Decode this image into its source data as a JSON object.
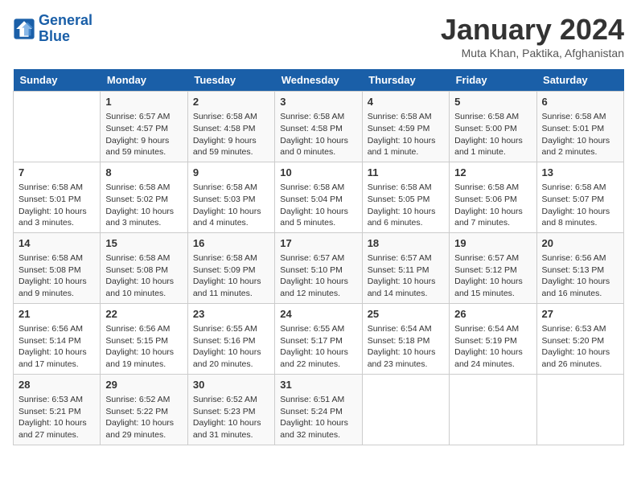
{
  "header": {
    "logo_line1": "General",
    "logo_line2": "Blue",
    "month": "January 2024",
    "location": "Muta Khan, Paktika, Afghanistan"
  },
  "days_of_week": [
    "Sunday",
    "Monday",
    "Tuesday",
    "Wednesday",
    "Thursday",
    "Friday",
    "Saturday"
  ],
  "weeks": [
    [
      {
        "num": "",
        "info": ""
      },
      {
        "num": "1",
        "info": "Sunrise: 6:57 AM\nSunset: 4:57 PM\nDaylight: 9 hours\nand 59 minutes."
      },
      {
        "num": "2",
        "info": "Sunrise: 6:58 AM\nSunset: 4:58 PM\nDaylight: 9 hours\nand 59 minutes."
      },
      {
        "num": "3",
        "info": "Sunrise: 6:58 AM\nSunset: 4:58 PM\nDaylight: 10 hours\nand 0 minutes."
      },
      {
        "num": "4",
        "info": "Sunrise: 6:58 AM\nSunset: 4:59 PM\nDaylight: 10 hours\nand 1 minute."
      },
      {
        "num": "5",
        "info": "Sunrise: 6:58 AM\nSunset: 5:00 PM\nDaylight: 10 hours\nand 1 minute."
      },
      {
        "num": "6",
        "info": "Sunrise: 6:58 AM\nSunset: 5:01 PM\nDaylight: 10 hours\nand 2 minutes."
      }
    ],
    [
      {
        "num": "7",
        "info": "Sunrise: 6:58 AM\nSunset: 5:01 PM\nDaylight: 10 hours\nand 3 minutes."
      },
      {
        "num": "8",
        "info": "Sunrise: 6:58 AM\nSunset: 5:02 PM\nDaylight: 10 hours\nand 3 minutes."
      },
      {
        "num": "9",
        "info": "Sunrise: 6:58 AM\nSunset: 5:03 PM\nDaylight: 10 hours\nand 4 minutes."
      },
      {
        "num": "10",
        "info": "Sunrise: 6:58 AM\nSunset: 5:04 PM\nDaylight: 10 hours\nand 5 minutes."
      },
      {
        "num": "11",
        "info": "Sunrise: 6:58 AM\nSunset: 5:05 PM\nDaylight: 10 hours\nand 6 minutes."
      },
      {
        "num": "12",
        "info": "Sunrise: 6:58 AM\nSunset: 5:06 PM\nDaylight: 10 hours\nand 7 minutes."
      },
      {
        "num": "13",
        "info": "Sunrise: 6:58 AM\nSunset: 5:07 PM\nDaylight: 10 hours\nand 8 minutes."
      }
    ],
    [
      {
        "num": "14",
        "info": "Sunrise: 6:58 AM\nSunset: 5:08 PM\nDaylight: 10 hours\nand 9 minutes."
      },
      {
        "num": "15",
        "info": "Sunrise: 6:58 AM\nSunset: 5:08 PM\nDaylight: 10 hours\nand 10 minutes."
      },
      {
        "num": "16",
        "info": "Sunrise: 6:58 AM\nSunset: 5:09 PM\nDaylight: 10 hours\nand 11 minutes."
      },
      {
        "num": "17",
        "info": "Sunrise: 6:57 AM\nSunset: 5:10 PM\nDaylight: 10 hours\nand 12 minutes."
      },
      {
        "num": "18",
        "info": "Sunrise: 6:57 AM\nSunset: 5:11 PM\nDaylight: 10 hours\nand 14 minutes."
      },
      {
        "num": "19",
        "info": "Sunrise: 6:57 AM\nSunset: 5:12 PM\nDaylight: 10 hours\nand 15 minutes."
      },
      {
        "num": "20",
        "info": "Sunrise: 6:56 AM\nSunset: 5:13 PM\nDaylight: 10 hours\nand 16 minutes."
      }
    ],
    [
      {
        "num": "21",
        "info": "Sunrise: 6:56 AM\nSunset: 5:14 PM\nDaylight: 10 hours\nand 17 minutes."
      },
      {
        "num": "22",
        "info": "Sunrise: 6:56 AM\nSunset: 5:15 PM\nDaylight: 10 hours\nand 19 minutes."
      },
      {
        "num": "23",
        "info": "Sunrise: 6:55 AM\nSunset: 5:16 PM\nDaylight: 10 hours\nand 20 minutes."
      },
      {
        "num": "24",
        "info": "Sunrise: 6:55 AM\nSunset: 5:17 PM\nDaylight: 10 hours\nand 22 minutes."
      },
      {
        "num": "25",
        "info": "Sunrise: 6:54 AM\nSunset: 5:18 PM\nDaylight: 10 hours\nand 23 minutes."
      },
      {
        "num": "26",
        "info": "Sunrise: 6:54 AM\nSunset: 5:19 PM\nDaylight: 10 hours\nand 24 minutes."
      },
      {
        "num": "27",
        "info": "Sunrise: 6:53 AM\nSunset: 5:20 PM\nDaylight: 10 hours\nand 26 minutes."
      }
    ],
    [
      {
        "num": "28",
        "info": "Sunrise: 6:53 AM\nSunset: 5:21 PM\nDaylight: 10 hours\nand 27 minutes."
      },
      {
        "num": "29",
        "info": "Sunrise: 6:52 AM\nSunset: 5:22 PM\nDaylight: 10 hours\nand 29 minutes."
      },
      {
        "num": "30",
        "info": "Sunrise: 6:52 AM\nSunset: 5:23 PM\nDaylight: 10 hours\nand 31 minutes."
      },
      {
        "num": "31",
        "info": "Sunrise: 6:51 AM\nSunset: 5:24 PM\nDaylight: 10 hours\nand 32 minutes."
      },
      {
        "num": "",
        "info": ""
      },
      {
        "num": "",
        "info": ""
      },
      {
        "num": "",
        "info": ""
      }
    ]
  ]
}
